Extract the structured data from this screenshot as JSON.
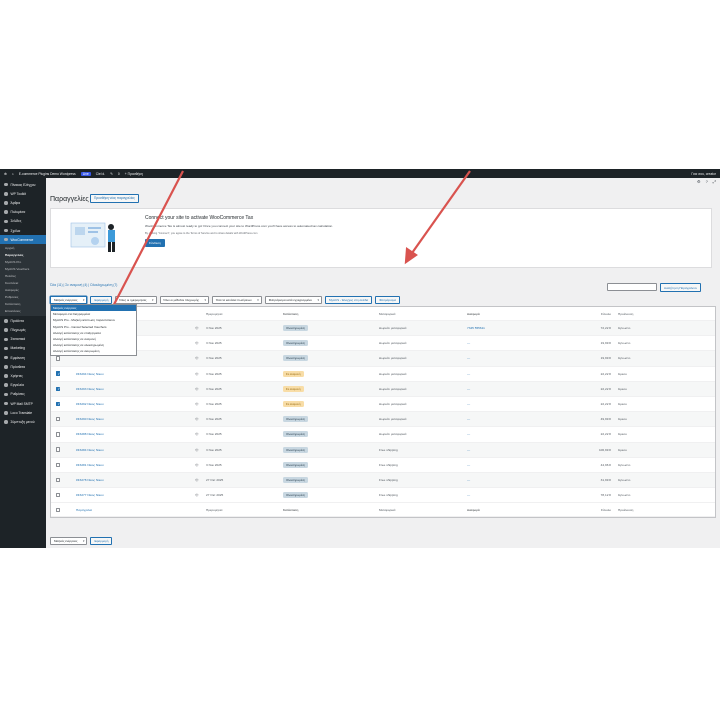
{
  "admin_bar": {
    "site": "E-commerce Plugins Demo Wordpress",
    "badge": "Live",
    "comments": "0",
    "updates": "Ciel d.",
    "new": "Προσθήκη",
    "user": "Γεια σου, creator"
  },
  "sidebar": {
    "items": [
      {
        "label": "Πίνακας Ελέγχου"
      },
      {
        "label": "WP Toolkit"
      },
      {
        "label": "Άρθρα"
      },
      {
        "label": "Πολυμέσα"
      },
      {
        "label": "Σελίδες"
      },
      {
        "label": "Σχόλια"
      },
      {
        "label": "WooCommerce"
      }
    ],
    "woo_sub": [
      "Αρχική",
      "Παραγγελίες",
      "MyACS Pro",
      "MyACS Vouchers",
      "Πελάτες",
      "Κουπόνια",
      "Αναφορές",
      "Ρυθμίσεις",
      "Κατάσταση",
      "Επεκτάσεις"
    ],
    "items2": [
      {
        "label": "Προϊόντα"
      },
      {
        "label": "Πληρωμές"
      },
      {
        "label": "Στατιστικά"
      },
      {
        "label": "Marketing"
      },
      {
        "label": "Εμφάνιση"
      },
      {
        "label": "Πρόσθετα"
      },
      {
        "label": "Χρήστες"
      },
      {
        "label": "Εργαλεία"
      },
      {
        "label": "Ρυθμίσεις"
      },
      {
        "label": "WP Mail SMTP"
      },
      {
        "label": "Loco Translate"
      },
      {
        "label": "Σύμπτυξη μενού"
      }
    ]
  },
  "page": {
    "title": "Παραγγελίες",
    "add_new": "Προσθήκη νέας παραγγελίας"
  },
  "notice": {
    "title": "Connect your site to activate WooCommerce Tax",
    "text": "WooCommerce Tax is almost ready to go! Once you connect your site to WordPress.com you'll have access to automated tax calculation.",
    "small": "By clicking \"Connect\", you agree to the Terms of Service and to share details with WordPress.com",
    "button": "Σύνδεση"
  },
  "subsubsub": "Όλα (11) | Σε αναμονή (4) | Ολοκληρωμένη (7)",
  "search_button": "Αναζήτηση Παραγγελιών",
  "filters": {
    "bulk": "Μαζικές ενέργειες",
    "apply": "Εφαρμογή",
    "dates": "Όλες οι ημερομηνίες",
    "payment": "Όλοι οι μέθοδοι πληρωμής",
    "shipping": "Όλα τα κανάλια πωλήσεων",
    "customer": "Φιλτράρισμα κατά εγγεγραμμένο",
    "myacs": "MyACS - Έλεγχος στη σελίδα",
    "filter_btn": "Φιλτράρισμα"
  },
  "dropdown": [
    "Μαζικές ενέργειες",
    "Μεταφορά στα διαγραμμένα",
    "MyACS Pro - Μαζική εκτύπωση παραστατικών",
    "MyACS Pro - Cancel Selected Vouchers",
    "Αλλαγή κατάστασης σε επεξεργασία",
    "Αλλαγή κατάστασης σε αναμονή",
    "Αλλαγή κατάστασης σε ολοκληρωμένη",
    "Αλλαγή κατάστασης σε ακυρωμένη"
  ],
  "columns": {
    "order": "Παραγγελία",
    "date": "Ημερομηνία",
    "status": "Κατάσταση",
    "shipping": "Μεταφορικά",
    "tracking": "Αναφορά",
    "total": "Σύνολο",
    "source": "Προέλευση"
  },
  "rows": [
    {
      "order": "",
      "date": "3 Νοε 2025",
      "status": "Ολοκληρωμένη",
      "shipping": "Δωρεάν μεταφορικά",
      "tracking": "7345 555611",
      "total": "72,22 €",
      "source": "Άγνωστο",
      "checked": false
    },
    {
      "order": "",
      "date": "3 Νοε 2025",
      "status": "Ολοκληρωμένη",
      "shipping": "Δωρεάν μεταφορικά",
      "tracking": "—",
      "total": "19,99 €",
      "source": "Άγνωστο",
      "checked": false
    },
    {
      "order": "",
      "date": "3 Νοε 2025",
      "status": "Ολοκληρωμένη",
      "shipping": "Δωρεάν μεταφορικά",
      "tracking": "—",
      "total": "19,99 €",
      "source": "Άγνωστο",
      "checked": false
    },
    {
      "order": "#F3294 Νίκος Νίκου",
      "date": "3 Νοε 2025",
      "status": "Σε αναμονή",
      "shipping": "Δωρεάν μεταφορικά",
      "tracking": "—",
      "total": "22,22 €",
      "source": "Άμεσο",
      "checked": true
    },
    {
      "order": "#F3293 Νίκος Νίκου",
      "date": "3 Νοε 2025",
      "status": "Σε αναμονή",
      "shipping": "Δωρεάν μεταφορικά",
      "tracking": "—",
      "total": "22,22 €",
      "source": "Άμεσο",
      "checked": true
    },
    {
      "order": "#F3292 Νίκος Νίκου",
      "date": "3 Νοε 2025",
      "status": "Σε αναμονή",
      "shipping": "Δωρεάν μεταφορικά",
      "tracking": "—",
      "total": "22,22 €",
      "source": "Άμεσο",
      "checked": true
    },
    {
      "order": "#F3290 Νίκος Νίκου",
      "date": "3 Νοε 2025",
      "status": "Ολοκληρωμένη",
      "shipping": "Δωρεάν μεταφορικά",
      "tracking": "—",
      "total": "49,99 €",
      "source": "Άμεσο",
      "checked": false
    },
    {
      "order": "#F3288 Νίκος Νίκου",
      "date": "3 Νοε 2025",
      "status": "Ολοκληρωμένη",
      "shipping": "Δωρεάν μεταφορικά",
      "tracking": "—",
      "total": "22,22 €",
      "source": "Άμεσο",
      "checked": false
    },
    {
      "order": "#F3284 Νίκος Νίκου",
      "date": "3 Νοε 2025",
      "status": "Ολοκληρωμένη",
      "shipping": "Free shipping",
      "tracking": "—",
      "total": "106,99 €",
      "source": "Άμεσο",
      "checked": false
    },
    {
      "order": "#F3281 Νίκος Νίκου",
      "date": "3 Νοε 2025",
      "status": "Ολοκληρωμένη",
      "shipping": "Free shipping",
      "tracking": "—",
      "total": "44,96 €",
      "source": "Άγνωστο",
      "checked": false
    },
    {
      "order": "#F3278 Νίκος Νίκου",
      "date": "27 Οκτ 2025",
      "status": "Ολοκληρωμένη",
      "shipping": "Free shipping",
      "tracking": "—",
      "total": "31,99 €",
      "source": "Άγνωστο",
      "checked": false
    },
    {
      "order": "#F3277 Νίκος Νίκου",
      "date": "27 Οκτ 2025",
      "status": "Ολοκληρωμένη",
      "shipping": "Free shipping",
      "tracking": "—",
      "total": "78,12 €",
      "source": "Άγνωστο",
      "checked": false
    }
  ],
  "colors": {
    "accent": "#2271b1",
    "admin_bg": "#1d2327",
    "status_done": "#c8d7e1",
    "status_hold": "#f8dda7",
    "arrow": "#d9534f"
  }
}
